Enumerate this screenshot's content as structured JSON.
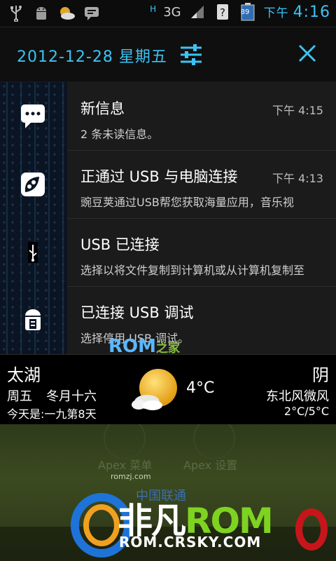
{
  "status_bar": {
    "network_type": "H",
    "signal_label": "3G",
    "battery": "89",
    "ampm": "下午",
    "time": "4:16"
  },
  "header": {
    "date": "2012-12-28 星期五"
  },
  "notifications": [
    {
      "title": "新信息",
      "time": "下午 4:15",
      "subtitle": "2 条未读信息。",
      "icon": "message-icon"
    },
    {
      "title": "正通过 USB 与电脑连接",
      "time": "下午 4:13",
      "subtitle": "豌豆荚通过USB帮您获取海量应用，音乐视",
      "icon": "wandoujia-icon"
    },
    {
      "title": "USB 已连接",
      "time": "",
      "subtitle": "选择以将文件复制到计算机或从计算机复制至",
      "icon": "usb-icon"
    },
    {
      "title": "已连接 USB 调试",
      "time": "",
      "subtitle": "选择停用 USB 调试。",
      "icon": "android-debug-icon"
    }
  ],
  "weather": {
    "city": "太湖",
    "weekday": "周五",
    "lunar": "冬月十六",
    "days_info": "今天是:一九第8天",
    "temperature": "4°C",
    "condition": "阴",
    "wind": "东北风微风",
    "range": "2°C/5°C"
  },
  "home": {
    "apex_menu": "Apex 菜单",
    "apex_settings": "Apex 设置",
    "small_site": "romzj.com",
    "carrier": "中国联通"
  },
  "watermark": {
    "rom_mid": "ROM",
    "jia": "之家",
    "brand_cn": "非凡",
    "brand_rom": "ROM",
    "url": "ROM.CRSKY.COM"
  },
  "colors": {
    "accent": "#3cc3f3",
    "notification_bg": "#1b1b1b"
  }
}
